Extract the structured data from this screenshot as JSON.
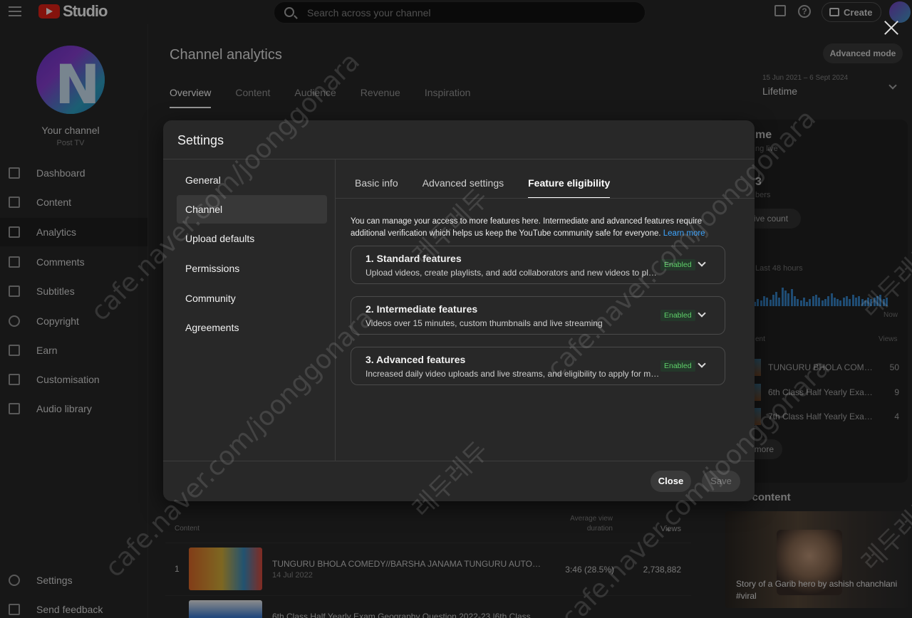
{
  "topbar": {
    "logo_text": "Studio",
    "search_placeholder": "Search across your channel",
    "create_label": "Create"
  },
  "sidebar": {
    "channel_name": "Your channel",
    "channel_sub": "Post TV",
    "items": [
      {
        "label": "Dashboard",
        "icon": "dashboard-icon"
      },
      {
        "label": "Content",
        "icon": "content-icon"
      },
      {
        "label": "Analytics",
        "icon": "analytics-icon"
      },
      {
        "label": "Comments",
        "icon": "comments-icon"
      },
      {
        "label": "Subtitles",
        "icon": "subtitles-icon"
      },
      {
        "label": "Copyright",
        "icon": "copyright-icon"
      },
      {
        "label": "Earn",
        "icon": "earn-icon"
      },
      {
        "label": "Customisation",
        "icon": "customisation-icon"
      },
      {
        "label": "Audio library",
        "icon": "audio-library-icon"
      }
    ],
    "settings_label": "Settings",
    "feedback_label": "Send feedback"
  },
  "main": {
    "title": "Channel analytics",
    "tabs": [
      "Overview",
      "Content",
      "Audience",
      "Revenue",
      "Inspiration"
    ],
    "advanced_mode": "Advanced mode",
    "date_range": "15 Jun 2021 – 6 Sept 2024",
    "date_value": "Lifetime",
    "realtime": {
      "title": "me",
      "sub": "ng live",
      "subscribers": "3",
      "subscribers_label": "bers",
      "live_count_btn": "ive count",
      "last_48": "Last 48 hours",
      "now": "Now",
      "content_header": "ent",
      "views_header": "Views",
      "top_rows": [
        {
          "title": "TUNGURU BHOLA COMEDY/...",
          "views": "50"
        },
        {
          "title": "6th Class Half Yearly Exam O...",
          "views": "9"
        },
        {
          "title": "7th Class Half Yearly Exam 2...",
          "views": "4"
        }
      ],
      "see_more": "more"
    },
    "latest": {
      "title": "st content",
      "caption": "Story of a Garib hero by ashish chanchlani #viral"
    },
    "table": {
      "col_content": "Content",
      "col_avd": "Average view duration",
      "col_views": "Views",
      "rows": [
        {
          "idx": "1",
          "title": "TUNGURU BHOLA COMEDY//BARSHA JANAMA TUNGURU AUTO KU//TUN...",
          "date": "14 Jul 2022",
          "avd": "3:46  (28.5%)",
          "views": "2,738,882"
        },
        {
          "idx": "",
          "title": "6th Class Half Yearly Exam Geography Question 2022-23 |6th Class Half Ye...",
          "date": "",
          "avd": "",
          "views": ""
        }
      ]
    }
  },
  "dialog": {
    "title": "Settings",
    "nav": [
      "General",
      "Channel",
      "Upload defaults",
      "Permissions",
      "Community",
      "Agreements"
    ],
    "active_nav": "Channel",
    "subtabs": [
      "Basic info",
      "Advanced settings",
      "Feature eligibility"
    ],
    "active_subtab": "Feature eligibility",
    "intro": "You can manage your access to more features here. Intermediate and advanced features require additional verification which helps us keep the YouTube community safe for everyone.",
    "intro_link": "Learn more",
    "features": [
      {
        "title": "1. Standard features",
        "desc": "Upload videos, create playlists, and add collaborators and new videos to playlists",
        "status": "Enabled"
      },
      {
        "title": "2. Intermediate features",
        "desc": "Videos over 15 minutes, custom thumbnails and live streaming",
        "status": "Enabled"
      },
      {
        "title": "3. Advanced features",
        "desc": "Increased daily video uploads and live streams, and eligibility to apply for monetis...",
        "status": "Enabled"
      }
    ],
    "close_label": "Close",
    "save_label": "Save"
  },
  "watermarks": [
    "cafe.naver.com/joonggonara",
    "레두레두"
  ],
  "colors": {
    "accent_link": "#3ea6ff",
    "enabled_text": "#5fd16a",
    "youtube_red": "#e62117"
  }
}
